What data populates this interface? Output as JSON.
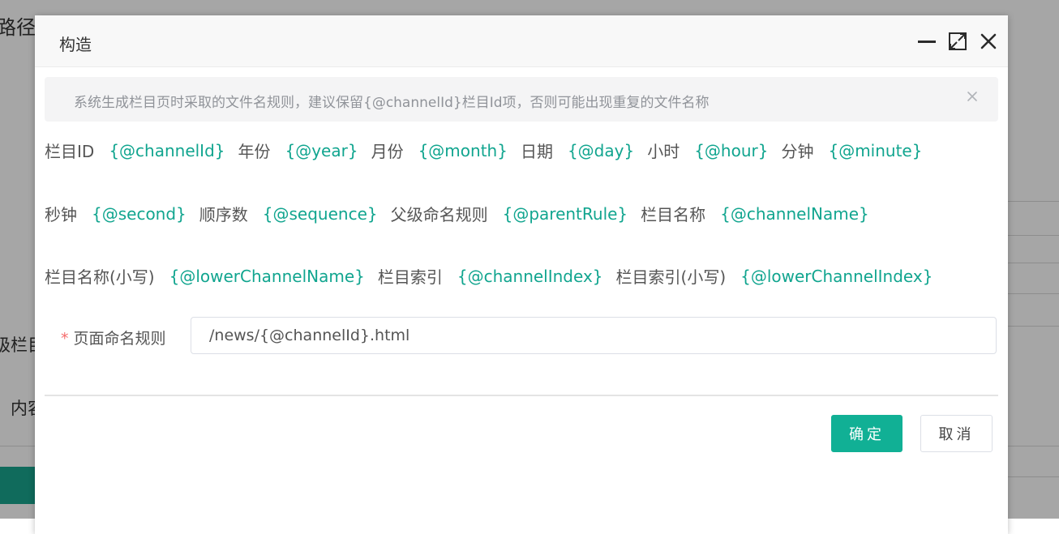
{
  "background": {
    "label_path": "路径",
    "label_parent_column": "级栏目",
    "label_content": "内容"
  },
  "dialog": {
    "title": "构造",
    "icons": [
      "minimize-icon",
      "maximize-icon",
      "close-icon"
    ]
  },
  "alert": {
    "text": "系统生成栏目页时采取的文件名规则，建议保留{@channelId}栏目Id项，否则可能出现重复的文件名称"
  },
  "variables": {
    "row1": [
      {
        "label": "栏目ID",
        "code": "{@channelId}"
      },
      {
        "label": "年份",
        "code": "{@year}"
      },
      {
        "label": "月份",
        "code": "{@month}"
      },
      {
        "label": "日期",
        "code": "{@day}"
      },
      {
        "label": "小时",
        "code": "{@hour}"
      },
      {
        "label": "分钟",
        "code": "{@minute}"
      }
    ],
    "row2": [
      {
        "label": "秒钟",
        "code": "{@second}"
      },
      {
        "label": "顺序数",
        "code": "{@sequence}"
      },
      {
        "label": "父级命名规则",
        "code": "{@parentRule}"
      },
      {
        "label": "栏目名称",
        "code": "{@channelName}"
      }
    ],
    "row3": [
      {
        "label": "栏目名称(小写)",
        "code": "{@lowerChannelName}"
      },
      {
        "label": "栏目索引",
        "code": "{@channelIndex}"
      },
      {
        "label": "栏目索引(小写)",
        "code": "{@lowerChannelIndex}"
      }
    ]
  },
  "form": {
    "required_mark": "*",
    "label": "页面命名规则",
    "value": "/news/{@channelId}.html"
  },
  "footer": {
    "ok_label": "确定",
    "cancel_label": "取消"
  },
  "colors": {
    "accent": "#11b095",
    "code_text": "#11a58f",
    "required": "#f56c6c"
  }
}
